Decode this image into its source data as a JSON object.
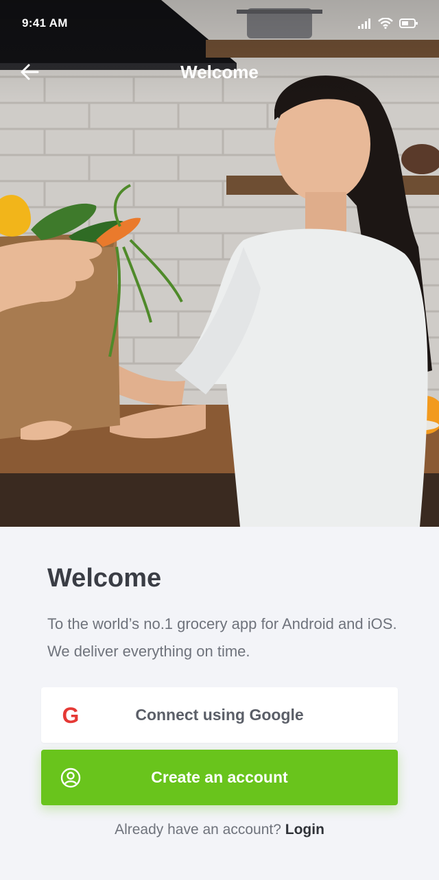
{
  "status_bar": {
    "time": "9:41 AM"
  },
  "nav": {
    "title": "Welcome"
  },
  "content": {
    "heading": "Welcome",
    "description": "To the world’s no.1 grocery app for Android and iOS. We deliver everything on time.",
    "google_button": {
      "label": "Connect using Google",
      "icon": "G"
    },
    "create_button": {
      "label": "Create an account"
    },
    "login_prompt": "Already have an account?",
    "login_link": "Login"
  },
  "colors": {
    "accent_green": "#69c41c",
    "google_red": "#e53935",
    "background": "#f3f4f8",
    "heading_text": "#3a3d45",
    "body_text": "#6f737c"
  },
  "icons": [
    "signal-icon",
    "wifi-icon",
    "battery-icon",
    "back-arrow-icon",
    "google-icon",
    "user-circle-icon"
  ]
}
